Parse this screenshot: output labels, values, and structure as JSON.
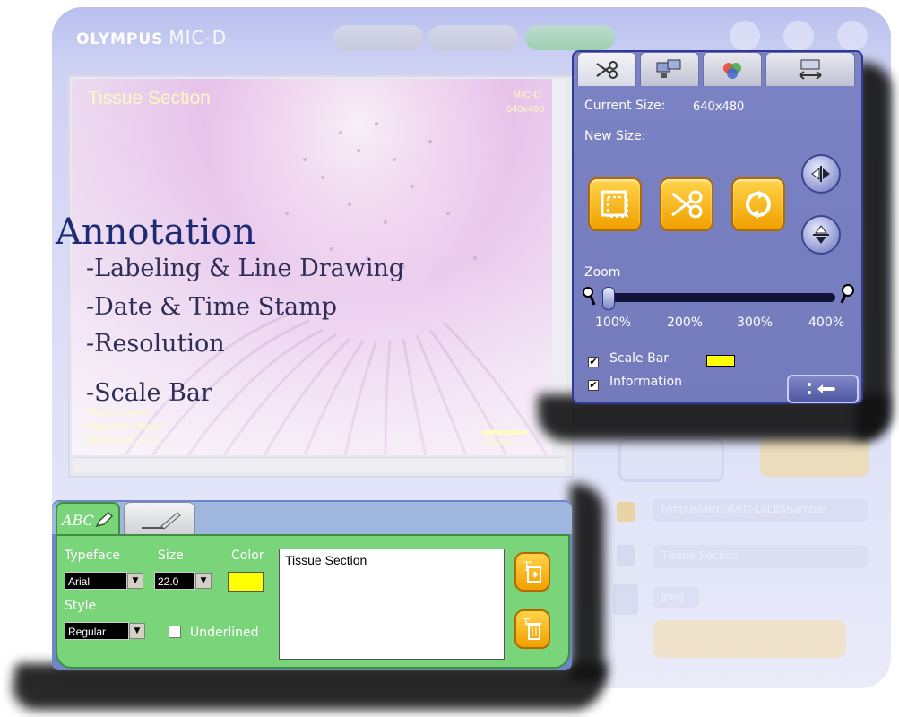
{
  "app": {
    "brand": "OLYMPUS",
    "product": "MIC-D"
  },
  "image": {
    "label": "Tissue Section",
    "corner_top": "MIC-D",
    "corner_res": "640x480",
    "footer_lines": [
      "Tissue Section",
      "Region of interest",
      "28.02.2003 17:01"
    ],
    "scale_text": "100um"
  },
  "annotation": {
    "title": "Annotation",
    "items": [
      "-Labeling & Line Drawing",
      "-Date & Time Stamp",
      "-Resolution",
      "-Scale Bar"
    ]
  },
  "resize_panel": {
    "tabs": [
      {
        "icon": "scissors-icon"
      },
      {
        "icon": "monitors-icon"
      },
      {
        "icon": "color-balls-icon"
      },
      {
        "icon": "resize-arrows-icon"
      }
    ],
    "current_size_label": "Current Size:",
    "current_size_value": "640x480",
    "new_size_label": "New Size:",
    "zoom_label": "Zoom",
    "zoom_ticks": [
      "100%",
      "200%",
      "300%",
      "400%"
    ],
    "zoom_value_percent": 100,
    "scale_bar_label": "Scale Bar",
    "scale_bar_checked": true,
    "scale_bar_color": "#ffff00",
    "information_label": "Information",
    "information_checked": true
  },
  "text_panel": {
    "tabs": [
      {
        "label": "ABC",
        "icon": "pencil-icon"
      },
      {
        "icon": "line-pen-icon"
      }
    ],
    "typeface_label": "Typeface",
    "typeface_value": "Arial",
    "size_label": "Size",
    "size_value": "22.0",
    "color_label": "Color",
    "color_value": "#ffff00",
    "style_label": "Style",
    "style_value": "Regular",
    "underlined_label": "Underlined",
    "underlined_checked": false,
    "text_value": "Tissue Section"
  },
  "background_controls": {
    "path": "lympusMicro\\MIC-D\\Lib\\Sample",
    "title_field": "Tissue Section",
    "format": "jpeg"
  }
}
